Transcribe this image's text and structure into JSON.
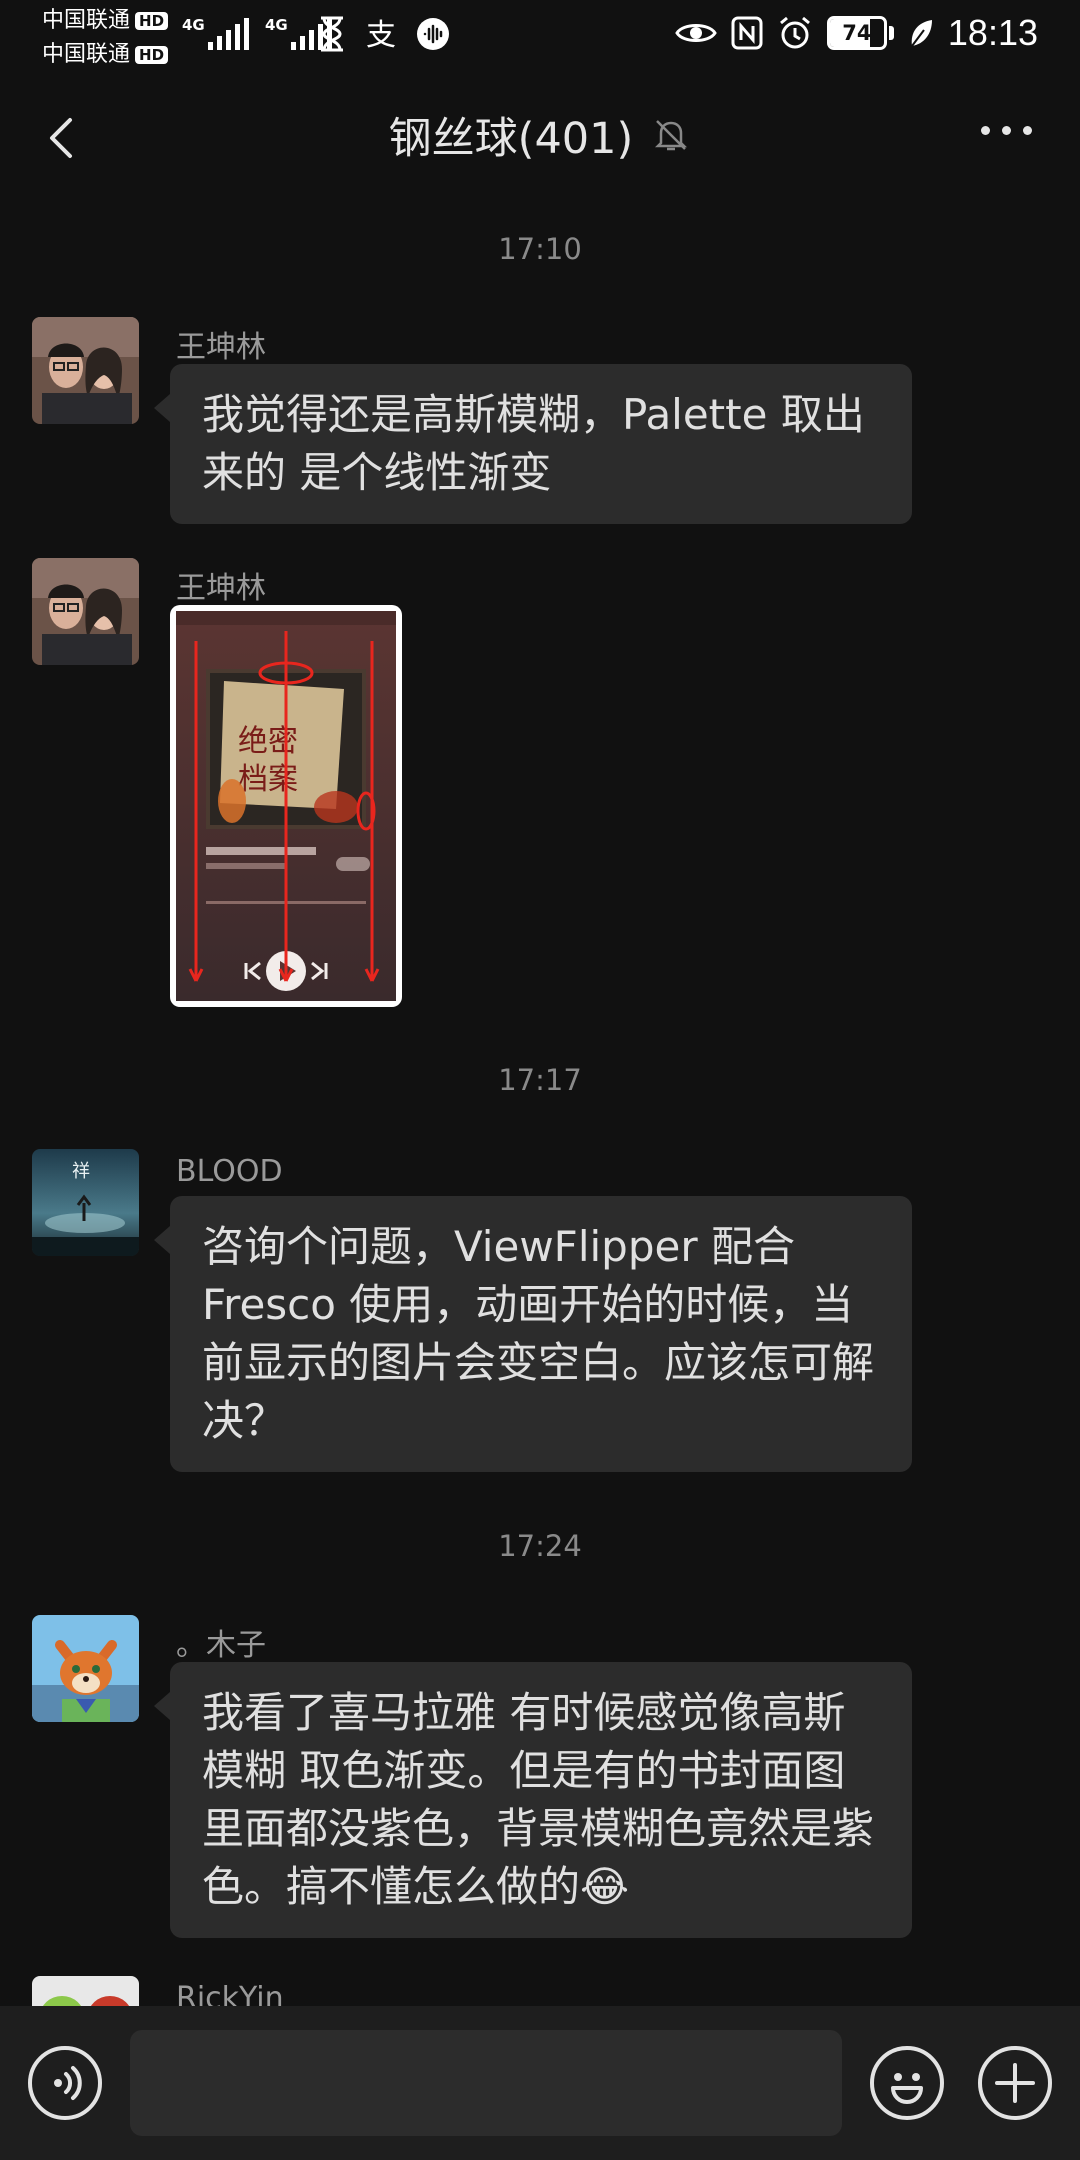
{
  "status_bar": {
    "carrier_1": "中国联通",
    "carrier_2": "中国联通",
    "hd_badge": "HD",
    "network_1": "4G",
    "network_2": "4G",
    "battery_level": "74",
    "time": "18:13"
  },
  "header": {
    "title": "钢丝球(401)",
    "muted": true
  },
  "messages": [
    {
      "time": "17:10"
    },
    {
      "sender": "王坤林",
      "text": "我觉得还是高斯模糊，Palette 取出来的 是个线性渐变"
    },
    {
      "sender": "王坤林",
      "type": "image"
    },
    {
      "time": "17:17"
    },
    {
      "sender": "BLOOD",
      "text": "咨询个问题，ViewFlipper 配合 Fresco 使用，动画开始的时候，当前显示的图片会变空白。应该怎可解决？"
    },
    {
      "time": "17:24"
    },
    {
      "sender": "。木子",
      "text": "我看了喜马拉雅 有时候感觉像高斯模糊 取色渐变。但是有的书封面图里面都没紫色，背景模糊色竟然是紫色。搞不懂怎么做的😂"
    },
    {
      "sender": "RickYin"
    }
  ],
  "input_bar": {
    "voice_icon": "voice-icon",
    "emoji_icon": "emoji-icon",
    "plus_icon": "plus-icon",
    "text_value": ""
  },
  "colors": {
    "background": "#111111",
    "bubble": "#2c2c2c",
    "input_bar": "#1e1e1e"
  }
}
